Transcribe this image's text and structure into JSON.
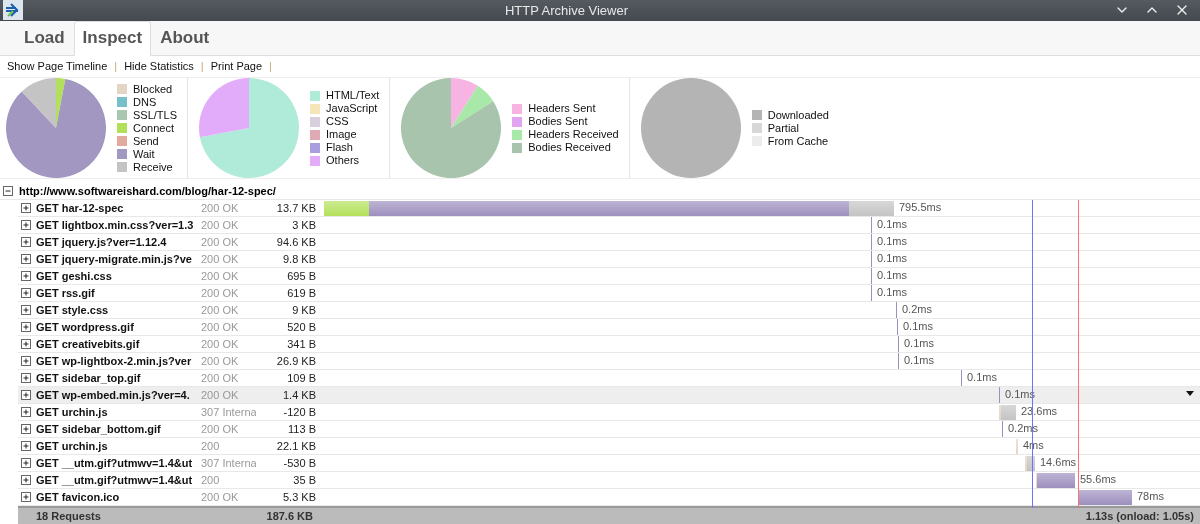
{
  "window": {
    "title": "HTTP Archive Viewer"
  },
  "tabs": [
    {
      "label": "Load",
      "selected": false
    },
    {
      "label": "Inspect",
      "selected": true
    },
    {
      "label": "About",
      "selected": false
    }
  ],
  "toolbar_links": [
    {
      "label": "Show Page Timeline",
      "separator": "|"
    },
    {
      "label": "Hide Statistics",
      "separator": "|"
    },
    {
      "label": "Print Page",
      "separator": "|"
    }
  ],
  "stats": [
    {
      "legend": [
        {
          "label": "Blocked",
          "color": "#e2d5c3"
        },
        {
          "label": "DNS",
          "color": "#77c0ca"
        },
        {
          "label": "SSL/TLS",
          "color": "#a9c6ae"
        },
        {
          "label": "Connect",
          "color": "#b3e05a"
        },
        {
          "label": "Send",
          "color": "#e2aa9c"
        },
        {
          "label": "Wait",
          "color": "#a297c0"
        },
        {
          "label": "Receive",
          "color": "#c4c4c4"
        }
      ]
    },
    {
      "legend": [
        {
          "label": "HTML/Text",
          "color": "#b0ead9"
        },
        {
          "label": "JavaScript",
          "color": "#f6e5b9"
        },
        {
          "label": "CSS",
          "color": "#d8cfdc"
        },
        {
          "label": "Image",
          "color": "#dfaab3"
        },
        {
          "label": "Flash",
          "color": "#a99fe0"
        },
        {
          "label": "Others",
          "color": "#e3acfb"
        }
      ]
    },
    {
      "legend": [
        {
          "label": "Headers Sent",
          "color": "#f7b4e3"
        },
        {
          "label": "Bodies Sent",
          "color": "#e2a3f0"
        },
        {
          "label": "Headers Received",
          "color": "#a8e8a8"
        },
        {
          "label": "Bodies Received",
          "color": "#a8c4ac"
        }
      ]
    },
    {
      "legend": [
        {
          "label": "Downloaded",
          "color": "#b4b4b4"
        },
        {
          "label": "Partial",
          "color": "#d7d7d7"
        },
        {
          "label": "From Cache",
          "color": "#ececec"
        }
      ]
    }
  ],
  "page": {
    "url": "http://www.softwareishard.com/blog/har-12-spec/",
    "expanded": true
  },
  "rows": [
    {
      "name": "GET har-12-spec",
      "status": "200 OK",
      "size": "13.7 KB",
      "time": "795.5ms",
      "selected": false
    },
    {
      "name": "GET lightbox.min.css?ver=1.3",
      "status": "200 OK",
      "size": "3 KB",
      "time": "0.1ms",
      "selected": false
    },
    {
      "name": "GET jquery.js?ver=1.12.4",
      "status": "200 OK",
      "size": "94.6 KB",
      "time": "0.1ms",
      "selected": false
    },
    {
      "name": "GET jquery-migrate.min.js?ve",
      "status": "200 OK",
      "size": "9.8 KB",
      "time": "0.1ms",
      "selected": false
    },
    {
      "name": "GET geshi.css",
      "status": "200 OK",
      "size": "695 B",
      "time": "0.1ms",
      "selected": false
    },
    {
      "name": "GET rss.gif",
      "status": "200 OK",
      "size": "619 B",
      "time": "0.1ms",
      "selected": false
    },
    {
      "name": "GET style.css",
      "status": "200 OK",
      "size": "9 KB",
      "time": "0.2ms",
      "selected": false
    },
    {
      "name": "GET wordpress.gif",
      "status": "200 OK",
      "size": "520 B",
      "time": "0.1ms",
      "selected": false
    },
    {
      "name": "GET creativebits.gif",
      "status": "200 OK",
      "size": "341 B",
      "time": "0.1ms",
      "selected": false
    },
    {
      "name": "GET wp-lightbox-2.min.js?ver",
      "status": "200 OK",
      "size": "26.9 KB",
      "time": "0.1ms",
      "selected": false
    },
    {
      "name": "GET sidebar_top.gif",
      "status": "200 OK",
      "size": "109 B",
      "time": "0.1ms",
      "selected": false
    },
    {
      "name": "GET wp-embed.min.js?ver=4.",
      "status": "200 OK",
      "size": "1.4 KB",
      "time": "0.1ms",
      "selected": true
    },
    {
      "name": "GET urchin.js",
      "status": "307 Interna",
      "size": "-120 B",
      "time": "23.6ms",
      "selected": false
    },
    {
      "name": "GET sidebar_bottom.gif",
      "status": "200 OK",
      "size": "113 B",
      "time": "0.2ms",
      "selected": false
    },
    {
      "name": "GET urchin.js",
      "status": "200",
      "size": "22.1 KB",
      "time": "4ms",
      "selected": false
    },
    {
      "name": "GET __utm.gif?utmwv=1.4&ut",
      "status": "307 Interna",
      "size": "-530 B",
      "time": "14.6ms",
      "selected": false
    },
    {
      "name": "GET __utm.gif?utmwv=1.4&ut",
      "status": "200",
      "size": "35 B",
      "time": "55.6ms",
      "selected": false
    },
    {
      "name": "GET favicon.ico",
      "status": "200 OK",
      "size": "5.3 KB",
      "time": "78ms",
      "selected": false
    }
  ],
  "footer": {
    "count": "18 Requests",
    "size": "187.6 KB",
    "timing": "1.13s (onload: 1.05s)"
  }
}
